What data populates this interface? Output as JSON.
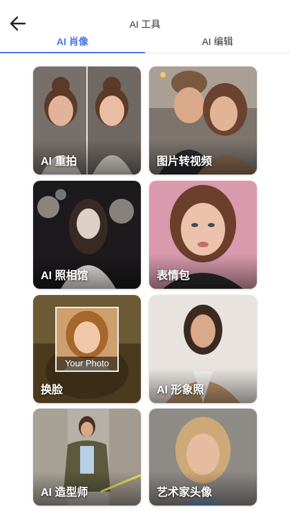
{
  "header": {
    "title": "AI 工具",
    "back_icon": "arrow-left-icon"
  },
  "tabs": [
    {
      "label": "AI 肖像",
      "active": true
    },
    {
      "label": "AI 编辑",
      "active": false
    }
  ],
  "colors": {
    "accent": "#4b74e6"
  },
  "cards": [
    {
      "label": "AI 重拍"
    },
    {
      "label": "图片转视频"
    },
    {
      "label": "AI 照相馆"
    },
    {
      "label": "表情包"
    },
    {
      "label": "换脸",
      "overlay": "Your Photo"
    },
    {
      "label": "AI 形象照"
    },
    {
      "label": "AI 造型师"
    },
    {
      "label": "艺术家头像"
    }
  ]
}
